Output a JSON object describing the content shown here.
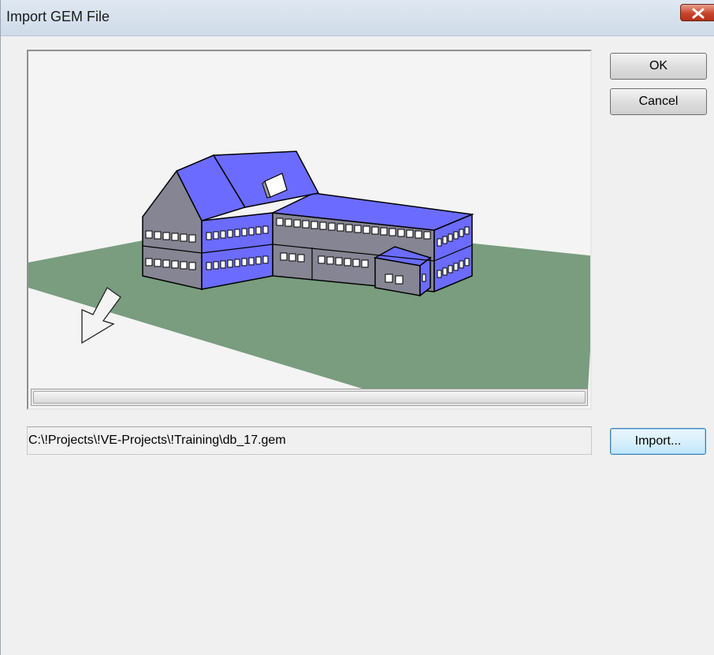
{
  "window": {
    "title": "Import GEM File"
  },
  "buttons": {
    "ok_label": "OK",
    "cancel_label": "Cancel",
    "import_label": "Import..."
  },
  "file": {
    "path": "C:\\!Projects\\!VE-Projects\\!Training\\db_17.gem"
  },
  "preview": {
    "model": "building-3d-model",
    "icons": [
      "compass-arrow-icon"
    ]
  },
  "colors": {
    "ground": "#799d7e",
    "roof": "#6b6bff",
    "walls": "#858593",
    "titlebar": "#d6e1ee",
    "close": "#c8452b"
  }
}
